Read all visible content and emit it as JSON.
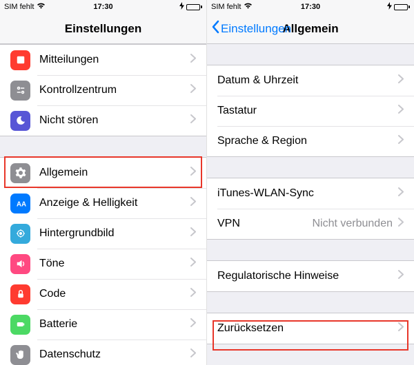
{
  "statusbar": {
    "carrier": "SIM fehlt",
    "time": "17:30"
  },
  "left": {
    "title": "Einstellungen",
    "group1": [
      {
        "label": "Mitteilungen"
      },
      {
        "label": "Kontrollzentrum"
      },
      {
        "label": "Nicht stören"
      }
    ],
    "group2": [
      {
        "label": "Allgemein"
      },
      {
        "label": "Anzeige & Helligkeit"
      },
      {
        "label": "Hintergrundbild"
      },
      {
        "label": "Töne"
      },
      {
        "label": "Code"
      },
      {
        "label": "Batterie"
      },
      {
        "label": "Datenschutz"
      }
    ]
  },
  "right": {
    "back": "Einstellungen",
    "title": "Allgemein",
    "group1": [
      {
        "label": "Datum & Uhrzeit"
      },
      {
        "label": "Tastatur"
      },
      {
        "label": "Sprache & Region"
      }
    ],
    "group2": [
      {
        "label": "iTunes-WLAN-Sync"
      },
      {
        "label": "VPN",
        "detail": "Nicht verbunden"
      }
    ],
    "group3": [
      {
        "label": "Regulatorische Hinweise"
      }
    ],
    "group4": [
      {
        "label": "Zurücksetzen"
      }
    ]
  }
}
